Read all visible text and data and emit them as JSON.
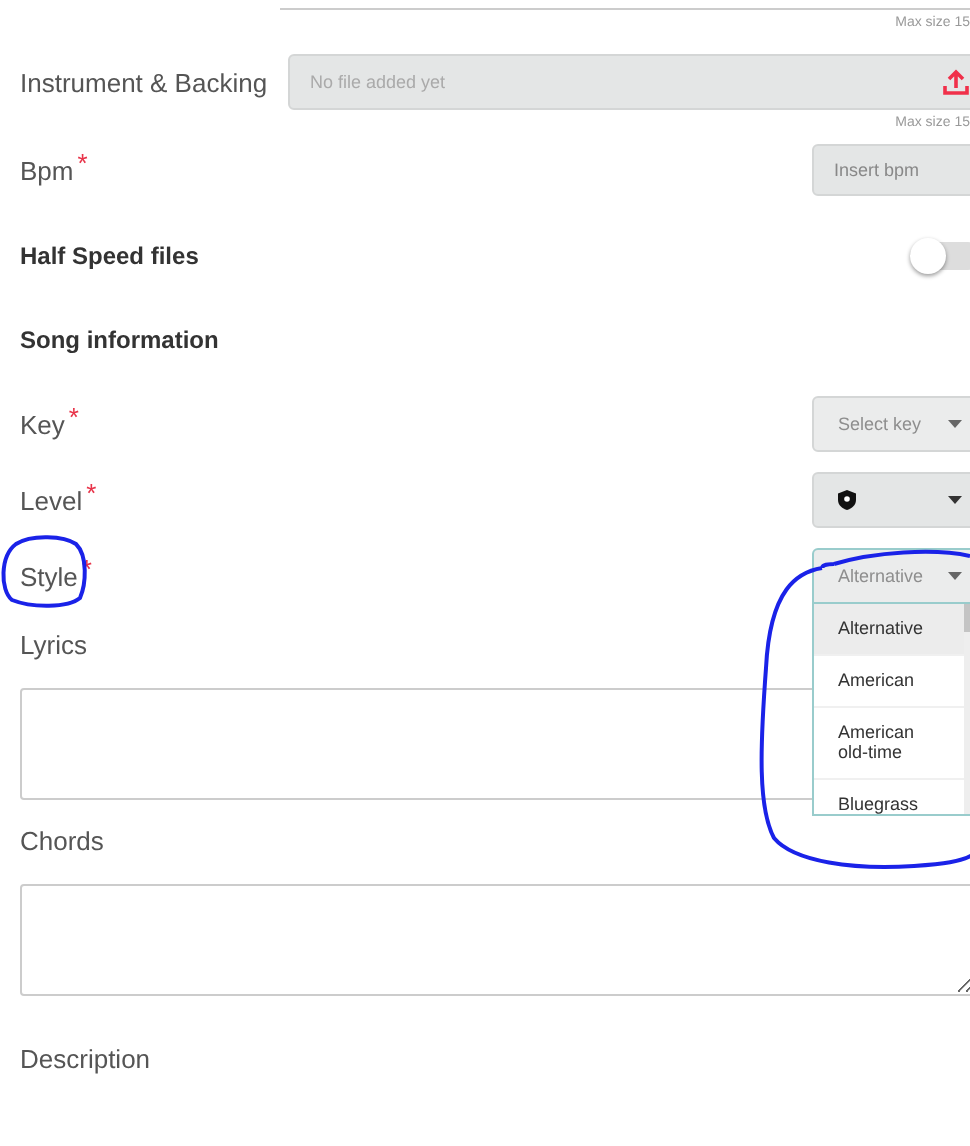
{
  "top_upload": {
    "hint": "Max size 15"
  },
  "instrument": {
    "label": "Instrument & Backing",
    "placeholder": "No file added yet",
    "hint": "Max size 15"
  },
  "required_mark": "*",
  "bpm": {
    "label": "Bpm",
    "required": true,
    "placeholder": "Insert bpm"
  },
  "half_speed": {
    "label": "Half Speed files",
    "on": false
  },
  "section_title": "Song information",
  "selects": [
    {
      "label": "Key",
      "required": true,
      "kind": "text",
      "placeholder": "Select key",
      "disabled": true,
      "open": false
    },
    {
      "label": "Level",
      "required": true,
      "kind": "icon",
      "disabled": false,
      "open": false
    },
    {
      "label": "Style",
      "required": true,
      "kind": "text",
      "placeholder": "Alternative",
      "disabled": true,
      "open": true,
      "options": [
        {
          "label": "Alternative",
          "selected": true
        },
        {
          "label": "American",
          "selected": false
        },
        {
          "label": "American old-time",
          "selected": false
        },
        {
          "label": "Bluegrass",
          "selected": false
        }
      ]
    }
  ],
  "textareas": [
    {
      "label": "Lyrics"
    },
    {
      "label": "Chords"
    }
  ],
  "description": {
    "label": "Description"
  }
}
